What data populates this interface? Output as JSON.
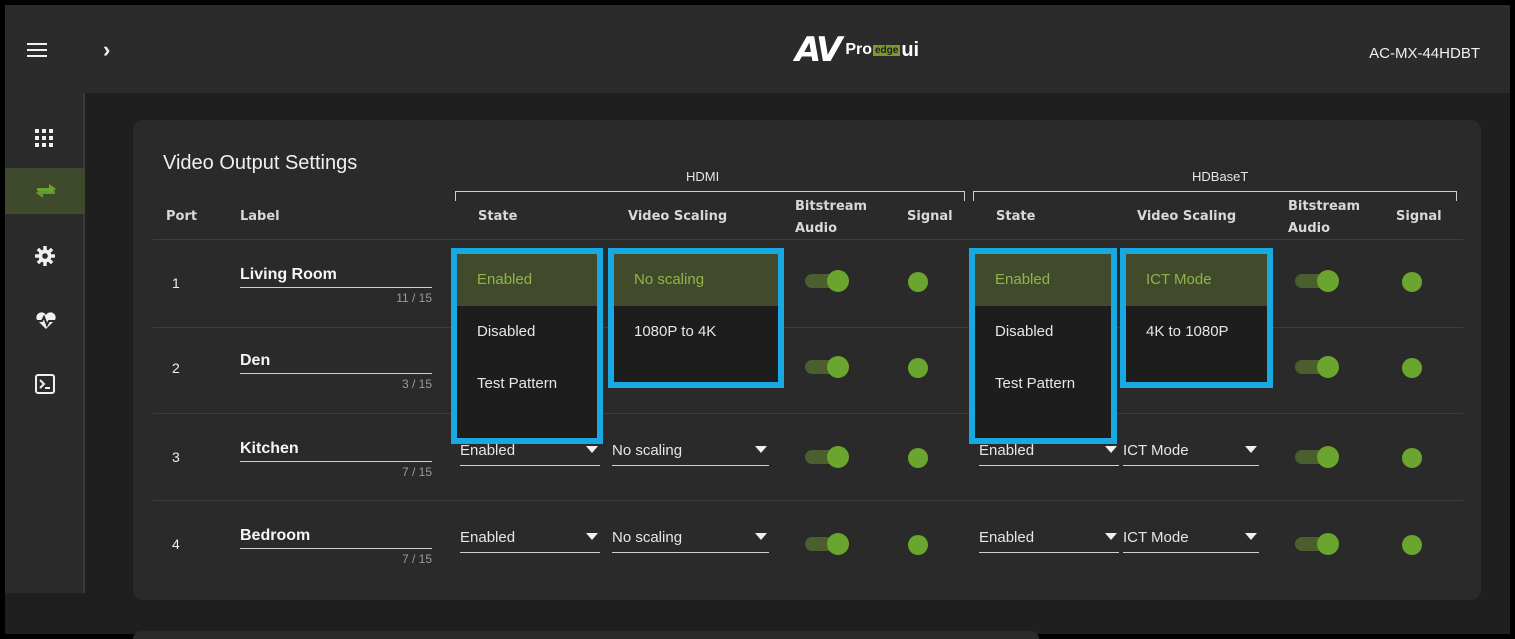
{
  "header": {
    "logo_av": "AV",
    "logo_pro": "Pro",
    "logo_edge": "edge",
    "logo_ui": "ui",
    "model": "AC-MX-44HDBT"
  },
  "sidebar": {
    "items": [
      {
        "icon": "grid-icon"
      },
      {
        "icon": "switch-arrows-icon",
        "active": true
      },
      {
        "icon": "gear-icon"
      },
      {
        "icon": "heart-pulse-icon"
      },
      {
        "icon": "terminal-icon"
      }
    ]
  },
  "card": {
    "title": "Video Output Settings",
    "groups": {
      "hdmi": "HDMI",
      "hdbaset": "HDBaseT"
    },
    "headers": {
      "port": "Port",
      "label": "Label",
      "hdmi_state": "State",
      "hdmi_scaling": "Video Scaling",
      "hdmi_bitstream_1": "Bitstream",
      "hdmi_bitstream_2": "Audio",
      "hdmi_signal": "Signal",
      "hdb_state": "State",
      "hdb_scaling": "Video Scaling",
      "hdb_bitstream_1": "Bitstream",
      "hdb_bitstream_2": "Audio",
      "hdb_signal": "Signal"
    },
    "rows": [
      {
        "port": "1",
        "label": "Living Room",
        "count": "11 / 15"
      },
      {
        "port": "2",
        "label": "Den",
        "count": "3 / 15"
      },
      {
        "port": "3",
        "label": "Kitchen",
        "count": "7 / 15",
        "hdmi_state": "Enabled",
        "hdmi_scaling": "No scaling",
        "hdb_state": "Enabled",
        "hdb_scaling": "ICT Mode"
      },
      {
        "port": "4",
        "label": "Bedroom",
        "count": "7 / 15",
        "hdmi_state": "Enabled",
        "hdmi_scaling": "No scaling",
        "hdb_state": "Enabled",
        "hdb_scaling": "ICT Mode"
      }
    ]
  },
  "menus": {
    "hdmi_state": [
      "Enabled",
      "Disabled",
      "Test Pattern"
    ],
    "hdmi_scaling": [
      "No scaling",
      "1080P to 4K"
    ],
    "hdb_state": [
      "Enabled",
      "Disabled",
      "Test Pattern"
    ],
    "hdb_scaling": [
      "ICT Mode",
      "4K to 1080P"
    ]
  },
  "colors": {
    "accent_green": "#6aa52f",
    "highlight_blue": "#19a9e1",
    "selected_text": "#8fb54a"
  }
}
